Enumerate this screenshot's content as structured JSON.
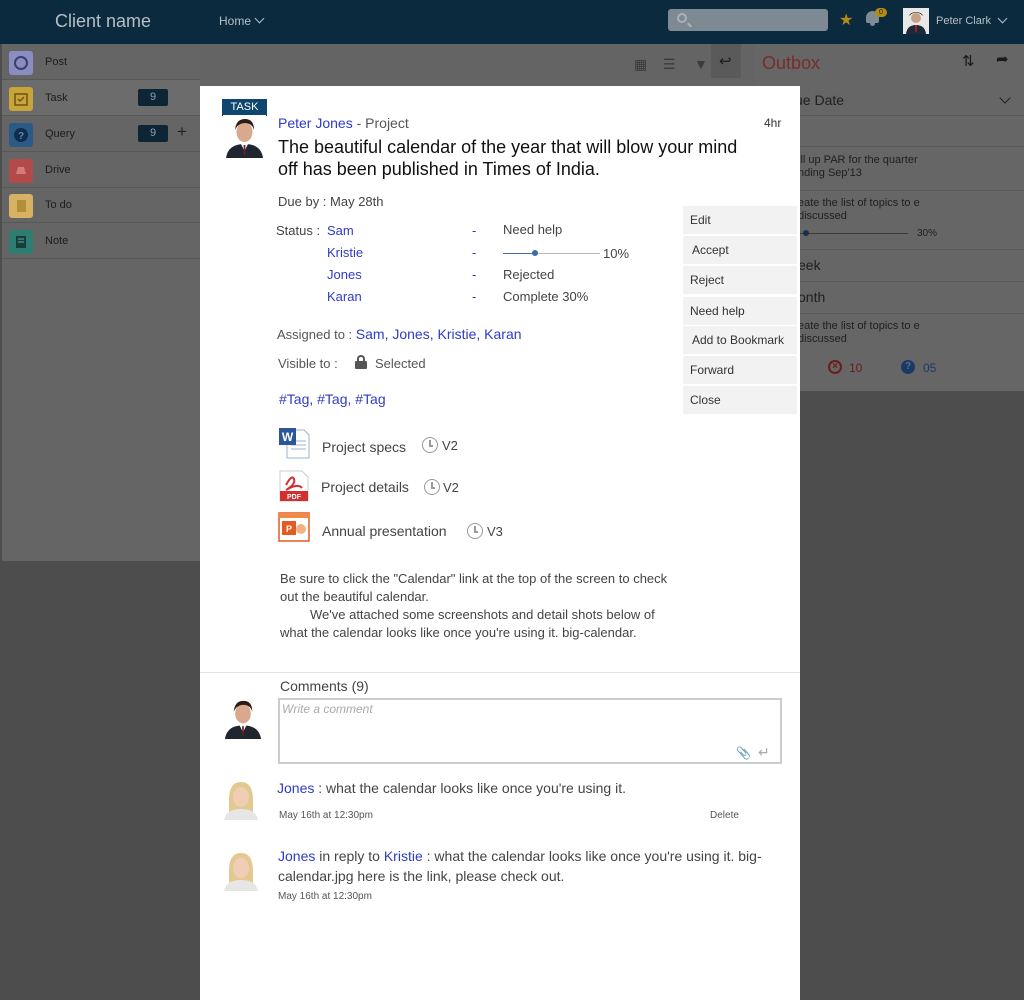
{
  "topbar": {
    "client_name": "Client name",
    "home_label": "Home",
    "search_placeholder": "",
    "notification_count": "0",
    "user_name": "Peter Clark"
  },
  "sidebar": {
    "items": [
      {
        "label": "Post",
        "icon": "post-icon",
        "color": "#8b8cc0"
      },
      {
        "label": "Task",
        "icon": "task-icon",
        "color": "#c9a43b",
        "count": "9"
      },
      {
        "label": "Query",
        "icon": "query-icon",
        "color": "#2c5a86",
        "count": "9",
        "plus": "+"
      },
      {
        "label": "Drive",
        "icon": "drive-icon",
        "color": "#b34a4a"
      },
      {
        "label": "To do",
        "icon": "todo-icon",
        "color": "#d7b264"
      },
      {
        "label": "Note",
        "icon": "note-icon",
        "color": "#2d7d72"
      }
    ]
  },
  "right_panel": {
    "title": "Outbox",
    "sort_label": "ue Date",
    "rows": [
      "ill up PAR for the quarter nding Sep'13",
      "eate the list of topics to e discussed",
      "30%",
      "eek",
      "onth",
      "eate the list of topics to e discussed"
    ],
    "rejected_count": "10",
    "query_count": "05"
  },
  "task": {
    "badge": "TASK",
    "author": "Peter Jones",
    "context": "- Project",
    "time": "4hr",
    "title": "The beautiful calendar of the year that will blow your mind off has been published in Times of India.",
    "due_by": "Due by : May 28th",
    "status_label": "Status :",
    "statuses": [
      {
        "name": "Sam",
        "dash": "-",
        "value": "Need help"
      },
      {
        "name": "Kristie",
        "dash": "-",
        "value": "",
        "progress": 0.33,
        "pct": "10%"
      },
      {
        "name": "Jones",
        "dash": "-",
        "value": "Rejected"
      },
      {
        "name": "Karan",
        "dash": "-",
        "value": "Complete 30%"
      }
    ],
    "assigned_label": "Assigned to : ",
    "assigned_people": "Sam, Jones, Kristie, Karan",
    "visible_label": "Visible to : ",
    "visible_value": "Selected",
    "tags": "#Tag, #Tag, #Tag",
    "files": [
      {
        "name": "Project specs",
        "version": "V2",
        "type": "word-icon"
      },
      {
        "name": "Project details",
        "version": "V2",
        "type": "pdf-icon"
      },
      {
        "name": "Annual presentation",
        "version": "V3",
        "type": "ppt-icon"
      }
    ],
    "description_1": "Be sure to click the \"Calendar\" link at the top of the screen to check out the beautiful  calendar.",
    "description_2": "We've attached some screenshots and detail shots below of what the calendar looks like once you're using it. big-calendar.",
    "actions": [
      "Edit",
      "Accept",
      "Reject",
      "Need help",
      "Add to Bookmark",
      "Forward",
      "Close"
    ]
  },
  "comments": {
    "title": "Comments (9)",
    "placeholder": "Write a comment",
    "items": [
      {
        "who": "Jones",
        "text": " : what the calendar looks like once you're using it.",
        "time": "May 16th at 12:30pm",
        "delete": "Delete"
      },
      {
        "who": "Jones",
        "middle": " in reply to ",
        "to": "Kristie",
        "text": " : what the calendar looks like once you're using it. big-calendar.jpg here is the link, please check out.",
        "time": "May 16th at 12:30pm"
      }
    ]
  },
  "colors": {
    "topbar": "#0c2a3e",
    "link": "#2e3bc7",
    "badge": "#0e4670",
    "outbox": "#7a2b2b"
  }
}
